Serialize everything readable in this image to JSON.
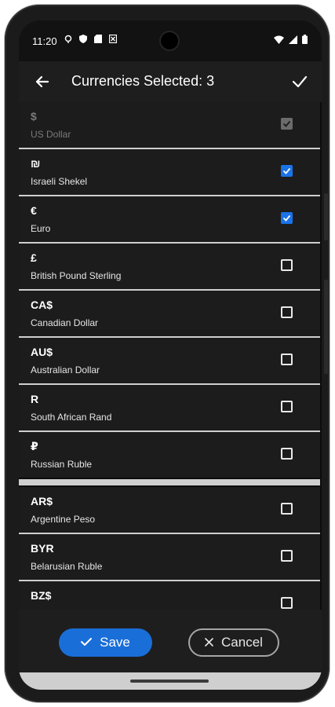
{
  "status_bar": {
    "time": "11:20"
  },
  "toolbar": {
    "title": "Currencies Selected:  3"
  },
  "currencies": [
    {
      "symbol": "$",
      "name": "US Dollar",
      "checked": true,
      "disabled": true
    },
    {
      "symbol": "₪",
      "name": "Israeli Shekel",
      "checked": true,
      "disabled": false
    },
    {
      "symbol": "€",
      "name": "Euro",
      "checked": true,
      "disabled": false
    },
    {
      "symbol": "£",
      "name": "British Pound Sterling",
      "checked": false,
      "disabled": false
    },
    {
      "symbol": "CA$",
      "name": "Canadian Dollar",
      "checked": false,
      "disabled": false
    },
    {
      "symbol": "AU$",
      "name": "Australian Dollar",
      "checked": false,
      "disabled": false
    },
    {
      "symbol": "R",
      "name": "South African Rand",
      "checked": false,
      "disabled": false
    },
    {
      "symbol": "₽",
      "name": "Russian Ruble",
      "checked": false,
      "disabled": false
    },
    {
      "symbol": "AR$",
      "name": "Argentine Peso",
      "checked": false,
      "disabled": false
    },
    {
      "symbol": "BYR",
      "name": "Belarusian Ruble",
      "checked": false,
      "disabled": false
    },
    {
      "symbol": "BZ$",
      "name": "",
      "checked": false,
      "disabled": false
    }
  ],
  "buttons": {
    "save_label": "Save",
    "cancel_label": "Cancel"
  },
  "colors": {
    "accent": "#1a73e8",
    "background": "#1c1c1c",
    "divider": "#cfcfcf"
  }
}
